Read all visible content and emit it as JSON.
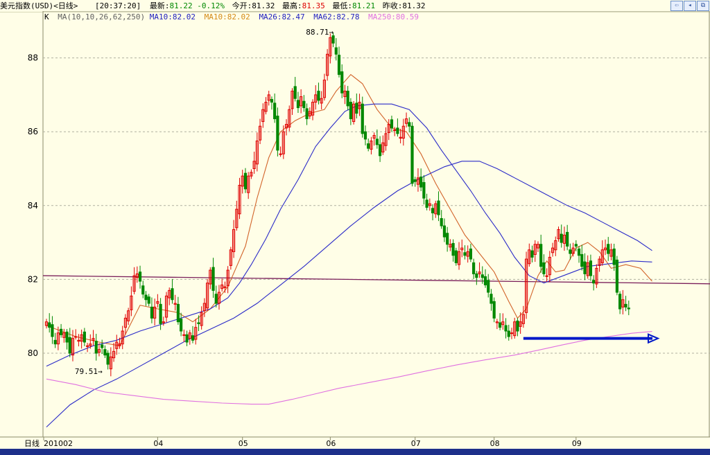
{
  "header": {
    "title": "美元指数(USD)<日线>",
    "time": "[20:37:20]",
    "latest_label": "最新:",
    "latest": "81.22",
    "change": "-0.12%",
    "open_label": "今开:",
    "open": "81.32",
    "high_label": "最高:",
    "high": "81.35",
    "low_label": "最低:",
    "low": "81.21",
    "prev_label": "昨收:",
    "prev": "81.32"
  },
  "ma_legend": {
    "k": "K",
    "params": "MA(10,10,26,62,250)",
    "ma10a": "MA10:82.02",
    "ma10b": "MA10:82.02",
    "ma26": "MA26:82.47",
    "ma62": "MA62:82.78",
    "ma250": "MA250:80.59"
  },
  "colors": {
    "background": "#fffee7",
    "up": "#e00000",
    "down": "#008800",
    "ma10": "#d2642a",
    "ma26": "#2a2ac8",
    "ma62": "#7a1e5a",
    "ma250": "#e070e0",
    "arrow": "#0018c8"
  },
  "chart_data": {
    "type": "candlestick",
    "title": "美元指数(USD)<日线>",
    "ylim": [
      77.8,
      89.4
    ],
    "y_ticks": [
      80,
      82,
      84,
      86,
      88
    ],
    "x_ticks": [
      {
        "label": "201002",
        "index": 0
      },
      {
        "label": "04",
        "index": 38
      },
      {
        "label": "05",
        "index": 67
      },
      {
        "label": "06",
        "index": 97
      },
      {
        "label": "07",
        "index": 126
      },
      {
        "label": "08",
        "index": 153
      },
      {
        "label": "09",
        "index": 181
      }
    ],
    "x_axis_label": "日线",
    "annotations": [
      {
        "text": "88.71",
        "index": 100,
        "value": 88.71,
        "type": "high"
      },
      {
        "text": "79.51",
        "index": 21,
        "value": 79.51,
        "type": "low"
      }
    ],
    "close": [
      80.85,
      80.7,
      80.45,
      80.25,
      80.55,
      80.5,
      80.55,
      80.3,
      80.0,
      80.4,
      80.45,
      80.35,
      80.5,
      80.3,
      80.2,
      80.25,
      80.4,
      80.0,
      80.1,
      80.15,
      79.95,
      79.7,
      79.9,
      80.05,
      80.3,
      80.25,
      80.6,
      80.95,
      81.15,
      81.55,
      82.1,
      82.15,
      81.95,
      81.6,
      81.45,
      81.35,
      80.95,
      81.25,
      81.4,
      80.8,
      80.85,
      81.55,
      81.7,
      81.45,
      81.35,
      80.85,
      80.6,
      80.5,
      80.3,
      80.55,
      80.35,
      80.7,
      80.8,
      81.1,
      81.35,
      81.9,
      82.25,
      81.7,
      81.35,
      81.65,
      81.85,
      81.8,
      82.25,
      82.8,
      83.35,
      83.9,
      84.55,
      84.8,
      84.45,
      84.8,
      84.9,
      85.2,
      85.75,
      86.15,
      86.6,
      86.8,
      87.0,
      86.8,
      86.35,
      85.5,
      85.4,
      86.0,
      86.2,
      86.6,
      87.1,
      86.9,
      86.65,
      86.95,
      86.65,
      86.35,
      86.55,
      86.8,
      87.0,
      86.85,
      86.9,
      87.4,
      88.1,
      88.55,
      88.4,
      88.1,
      87.55,
      87.05,
      87.1,
      86.7,
      86.35,
      86.75,
      86.5,
      86.8,
      85.95,
      85.8,
      85.55,
      85.75,
      85.9,
      85.65,
      85.35,
      85.7,
      85.95,
      86.2,
      86.1,
      86.05,
      85.95,
      85.85,
      86.15,
      86.35,
      86.15,
      84.6,
      84.65,
      84.75,
      84.5,
      84.2,
      83.95,
      84.05,
      83.8,
      84.05,
      83.75,
      83.45,
      83.15,
      82.95,
      82.95,
      82.65,
      82.45,
      82.75,
      82.85,
      82.65,
      82.75,
      82.55,
      82.15,
      82.05,
      82.2,
      82.05,
      81.85,
      81.65,
      81.35,
      80.95,
      80.85,
      80.7,
      80.85,
      80.6,
      80.45,
      80.55,
      80.85,
      80.6,
      80.85,
      81.05,
      82.55,
      82.8,
      82.6,
      82.95,
      82.95,
      82.35,
      82.15,
      82.1,
      82.6,
      82.85,
      83.05,
      83.35,
      83.0,
      83.2,
      82.9,
      82.7,
      82.85,
      82.9,
      82.65,
      82.35,
      82.15,
      82.45,
      82.1,
      81.9,
      82.3,
      82.55,
      82.8,
      82.85,
      82.7,
      82.8,
      82.4,
      81.65,
      81.2,
      81.45,
      81.25,
      81.2
    ],
    "moving_averages": [
      {
        "name": "MA10",
        "color": "#d2642a",
        "points": [
          [
            0,
            80.75
          ],
          [
            10,
            80.45
          ],
          [
            18,
            80.3
          ],
          [
            25,
            80.2
          ],
          [
            32,
            81.3
          ],
          [
            38,
            81.2
          ],
          [
            45,
            81.1
          ],
          [
            50,
            80.85
          ],
          [
            56,
            81.2
          ],
          [
            62,
            81.8
          ],
          [
            68,
            82.9
          ],
          [
            72,
            84.2
          ],
          [
            76,
            85.3
          ],
          [
            80,
            86.0
          ],
          [
            85,
            86.3
          ],
          [
            90,
            86.5
          ],
          [
            95,
            86.6
          ],
          [
            99,
            87.1
          ],
          [
            104,
            87.55
          ],
          [
            108,
            87.3
          ],
          [
            113,
            86.6
          ],
          [
            118,
            86.1
          ],
          [
            123,
            86.0
          ],
          [
            128,
            85.4
          ],
          [
            133,
            84.6
          ],
          [
            138,
            83.9
          ],
          [
            143,
            83.2
          ],
          [
            148,
            82.7
          ],
          [
            153,
            82.2
          ],
          [
            158,
            81.4
          ],
          [
            161,
            80.95
          ],
          [
            164,
            81.2
          ],
          [
            168,
            82.1
          ],
          [
            171,
            82.5
          ],
          [
            174,
            82.2
          ],
          [
            177,
            82.25
          ],
          [
            181,
            82.85
          ],
          [
            185,
            83.0
          ],
          [
            189,
            82.75
          ],
          [
            193,
            82.3
          ],
          [
            198,
            82.4
          ],
          [
            203,
            82.3
          ],
          [
            207,
            81.95
          ]
        ]
      },
      {
        "name": "MA26",
        "color": "#2a2ac8",
        "points": [
          [
            0,
            79.65
          ],
          [
            8,
            79.95
          ],
          [
            16,
            80.2
          ],
          [
            24,
            80.35
          ],
          [
            32,
            80.6
          ],
          [
            40,
            80.8
          ],
          [
            48,
            81.0
          ],
          [
            56,
            81.2
          ],
          [
            62,
            81.5
          ],
          [
            66,
            81.9
          ],
          [
            70,
            82.4
          ],
          [
            75,
            83.1
          ],
          [
            80,
            83.9
          ],
          [
            86,
            84.7
          ],
          [
            92,
            85.6
          ],
          [
            97,
            86.1
          ],
          [
            102,
            86.55
          ],
          [
            106,
            86.7
          ],
          [
            112,
            86.75
          ],
          [
            118,
            86.75
          ],
          [
            124,
            86.6
          ],
          [
            130,
            86.1
          ],
          [
            135,
            85.5
          ],
          [
            140,
            84.95
          ],
          [
            145,
            84.4
          ],
          [
            150,
            83.8
          ],
          [
            155,
            83.25
          ],
          [
            160,
            82.6
          ],
          [
            165,
            82.1
          ],
          [
            170,
            81.9
          ],
          [
            175,
            82.05
          ],
          [
            180,
            82.2
          ],
          [
            185,
            82.35
          ],
          [
            190,
            82.4
          ],
          [
            195,
            82.45
          ],
          [
            200,
            82.5
          ],
          [
            207,
            82.47
          ]
        ]
      },
      {
        "name": "MA62",
        "color": "#2a2ac8",
        "points": [
          [
            0,
            78.0
          ],
          [
            8,
            78.6
          ],
          [
            16,
            79.0
          ],
          [
            24,
            79.3
          ],
          [
            32,
            79.65
          ],
          [
            40,
            80.0
          ],
          [
            48,
            80.35
          ],
          [
            56,
            80.65
          ],
          [
            64,
            80.95
          ],
          [
            72,
            81.35
          ],
          [
            80,
            81.85
          ],
          [
            88,
            82.35
          ],
          [
            96,
            82.9
          ],
          [
            104,
            83.45
          ],
          [
            112,
            83.95
          ],
          [
            120,
            84.4
          ],
          [
            128,
            84.75
          ],
          [
            136,
            85.05
          ],
          [
            142,
            85.2
          ],
          [
            148,
            85.2
          ],
          [
            154,
            85.0
          ],
          [
            160,
            84.75
          ],
          [
            166,
            84.5
          ],
          [
            172,
            84.25
          ],
          [
            178,
            84.0
          ],
          [
            184,
            83.8
          ],
          [
            190,
            83.55
          ],
          [
            196,
            83.3
          ],
          [
            202,
            83.05
          ],
          [
            207,
            82.78
          ]
        ]
      },
      {
        "name": "MA250",
        "color": "#e070e0",
        "points": [
          [
            0,
            79.3
          ],
          [
            10,
            79.15
          ],
          [
            20,
            78.95
          ],
          [
            30,
            78.85
          ],
          [
            40,
            78.75
          ],
          [
            50,
            78.7
          ],
          [
            60,
            78.65
          ],
          [
            70,
            78.62
          ],
          [
            76,
            78.62
          ],
          [
            84,
            78.75
          ],
          [
            92,
            78.9
          ],
          [
            100,
            79.05
          ],
          [
            110,
            79.2
          ],
          [
            120,
            79.35
          ],
          [
            130,
            79.52
          ],
          [
            140,
            79.68
          ],
          [
            150,
            79.82
          ],
          [
            160,
            79.95
          ],
          [
            168,
            80.08
          ],
          [
            176,
            80.22
          ],
          [
            184,
            80.35
          ],
          [
            192,
            80.45
          ],
          [
            200,
            80.54
          ],
          [
            207,
            80.59
          ]
        ]
      }
    ],
    "horizontal_line": {
      "from": [
        0,
        82.1
      ],
      "to": [
        220,
        81.88
      ],
      "color": "#7a1e5a"
    },
    "arrow": {
      "from": [
        163,
        80.4
      ],
      "to": [
        209,
        80.4
      ],
      "color": "#0018c8"
    }
  }
}
